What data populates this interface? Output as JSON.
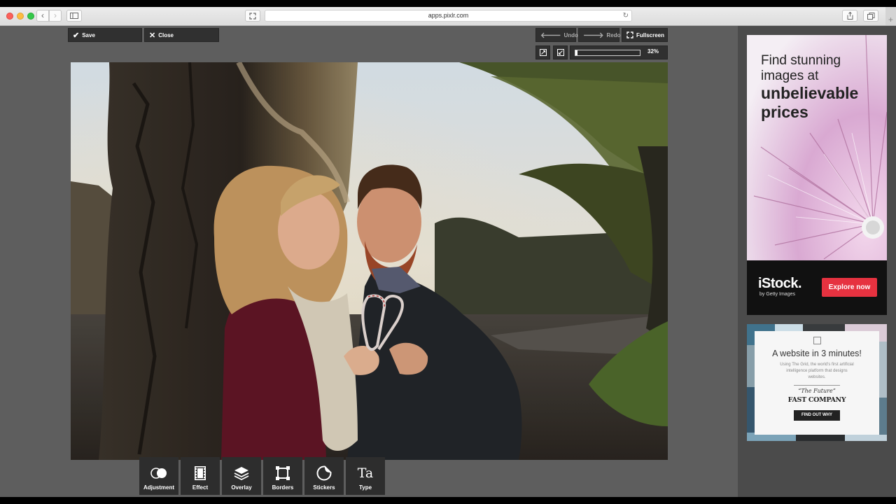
{
  "browser": {
    "url": "apps.pixlr.com",
    "back_icon": "‹",
    "forward_icon": "›",
    "new_tab_icon": "+"
  },
  "editor": {
    "save_label": "Save",
    "close_label": "Close",
    "undo_label": "Undo",
    "redo_label": "Redo",
    "fullscreen_label": "Fullscreen",
    "zoom": {
      "label": "32%",
      "value": 0.32
    }
  },
  "tools": [
    {
      "label": "Adjustment",
      "icon": "adjustment-icon"
    },
    {
      "label": "Effect",
      "icon": "effect-icon"
    },
    {
      "label": "Overlay",
      "icon": "overlay-icon"
    },
    {
      "label": "Borders",
      "icon": "borders-icon"
    },
    {
      "label": "Stickers",
      "icon": "stickers-icon"
    },
    {
      "label": "Type",
      "icon": "type-icon",
      "glyph": "Ta"
    }
  ],
  "ads": {
    "istock": {
      "line1": "Find stunning",
      "line2": "images at",
      "line3": "unbelievable",
      "line4": "prices",
      "brand": "iStock.",
      "brand_sub": "by Getty Images",
      "cta": "Explore now",
      "accent": "#e63240"
    },
    "grid": {
      "headline": "A website in 3 minutes!",
      "sub": "Using The Grid, the world's first artificial intelligence platform that designs websites.",
      "quote": "“The Future”",
      "publisher": "FAST COMPANY",
      "cta": "FIND OUT WHY"
    }
  }
}
